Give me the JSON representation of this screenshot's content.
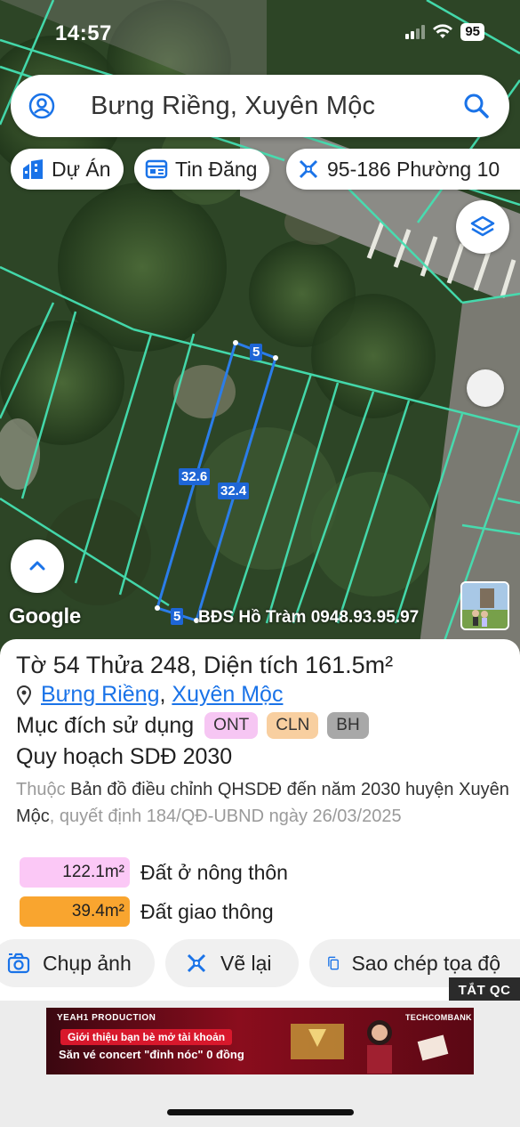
{
  "status_bar": {
    "time": "14:57",
    "battery": "95"
  },
  "search": {
    "query": "Bưng Riềng, Xuyên Mộc"
  },
  "chips": [
    {
      "label": "Dự Án",
      "icon": "buildings-icon"
    },
    {
      "label": "Tin Đăng",
      "icon": "listing-icon"
    },
    {
      "label": "95-186 Phường 10",
      "icon": "ruler-icon"
    }
  ],
  "map": {
    "edge_labels": [
      "5",
      "32.6",
      "32.4",
      "5"
    ],
    "attribution": "Google",
    "watermark": "BĐS Hồ Tràm 0948.93.95.97"
  },
  "parcel": {
    "title": {
      "to_label": "Tờ",
      "to_value": "54",
      "thua_label": "Thửa",
      "thua_value": "248",
      "area_label": "Diện tích",
      "area_value": "161.5m²"
    },
    "location": {
      "commune": "Bưng Riềng",
      "separator": ",",
      "district": "Xuyên Mộc"
    },
    "purpose": {
      "label": "Mục đích sử dụng",
      "tags": [
        {
          "code": "ONT",
          "color": "#f6c6f3"
        },
        {
          "code": "CLN",
          "color": "#f8cfa0"
        },
        {
          "code": "BH",
          "color": "#a8a8a8"
        }
      ]
    },
    "planning": {
      "title": "Quy hoạch SDĐ 2030",
      "desc_prefix": "Thuộc",
      "desc_main": "Bản đồ điều chỉnh QHSDĐ đến năm 2030 huyện Xuyên Mộc",
      "desc_suffix": ", quyết định 184/QĐ-UBND ngày 26/03/2025"
    },
    "zones": [
      {
        "area": "122.1m²",
        "name": "Đất ở nông thôn",
        "color": "#fbc8f6"
      },
      {
        "area": "39.4m²",
        "name": "Đất giao thông",
        "color": "#f9a52f"
      }
    ]
  },
  "actions": [
    {
      "label": "Chụp ảnh",
      "icon": "camera-icon"
    },
    {
      "label": "Vẽ lại",
      "icon": "redraw-icon"
    },
    {
      "label": "Sao chép tọa độ",
      "icon": "copy-icon"
    }
  ],
  "ads": {
    "close_label": "TẮT QC",
    "banner": {
      "brand_left": "YEAH1 PRODUCTION",
      "headline": "Giới thiệu bạn bè mở tài khoản",
      "subline": "Săn vé concert \"đỉnh nóc\" 0 đồng",
      "brand_right": "TECHCOMBANK"
    }
  }
}
